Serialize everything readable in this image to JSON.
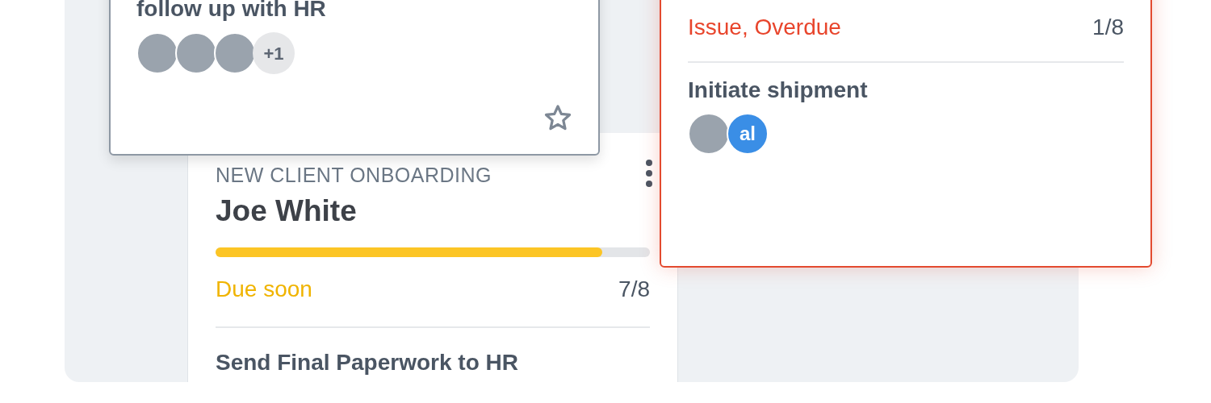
{
  "top_card": {
    "title": "follow up with HR",
    "avatars": [
      {
        "kind": "photo"
      },
      {
        "kind": "photo"
      },
      {
        "kind": "photo"
      }
    ],
    "more_count": "+1",
    "starred": false
  },
  "main_card": {
    "category": "NEW CLIENT ONBOARDING",
    "name": "Joe White",
    "progress": {
      "level": 0.89
    },
    "status": {
      "kind": "due_soon",
      "text": "Due soon"
    },
    "count": "7/8",
    "task": "Send Final Paperwork to HR"
  },
  "right_card": {
    "status": {
      "kind": "overdue",
      "text": "Issue, Overdue"
    },
    "count": "1/8",
    "task": "Initiate shipment",
    "avatars": [
      {
        "kind": "photo"
      },
      {
        "kind": "initials",
        "initials": "al",
        "color": "#3a8ee6"
      }
    ]
  }
}
